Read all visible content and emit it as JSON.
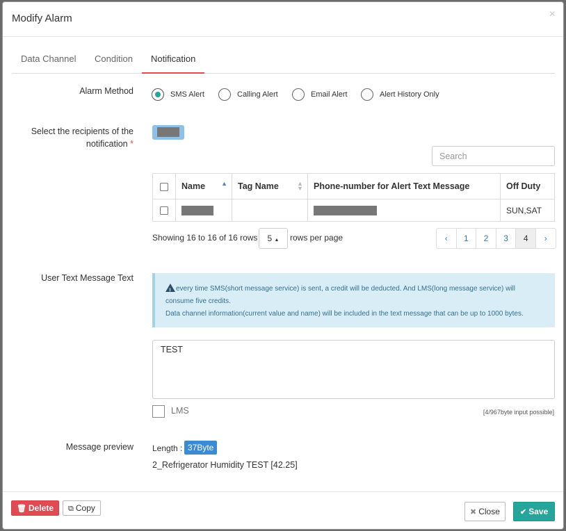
{
  "modal": {
    "title": "Modify Alarm",
    "close_glyph": "×"
  },
  "tabs": [
    {
      "label": "Data Channel",
      "active": false
    },
    {
      "label": "Condition",
      "active": false
    },
    {
      "label": "Notification",
      "active": true
    }
  ],
  "alarm_method": {
    "label": "Alarm Method",
    "options": [
      {
        "label": "SMS Alert",
        "selected": true
      },
      {
        "label": "Calling Alert",
        "selected": false
      },
      {
        "label": "Email Alert",
        "selected": false
      },
      {
        "label": "Alert History Only",
        "selected": false
      }
    ]
  },
  "recipients": {
    "label_line1": "Select the recipients of the",
    "label_line2": "notification",
    "required_mark": "*",
    "search_placeholder": "Search",
    "columns": [
      "Name",
      "Tag Name",
      "Phone-number for Alert Text Message",
      "Off Duty"
    ],
    "rows": [
      {
        "name": "",
        "tag_name": "",
        "phone": "",
        "off_duty": "SUN,SAT"
      }
    ],
    "showing_text": "Showing 16 to 16 of 16 rows",
    "rows_per_page_value": "5",
    "rows_per_page_label": "rows per page",
    "pages": [
      "‹",
      "1",
      "2",
      "3",
      "4",
      "›"
    ],
    "active_page": "4"
  },
  "user_text": {
    "label": "User Text Message Text",
    "alert_line1": "every time SMS(short message service) is sent, a credit will be deducted. And LMS(long message service) will",
    "alert_line2": "consume five credits.",
    "alert_line3": "Data channel information(current value and name) will be included in the text message that can be up to 1000 bytes.",
    "message_value": "TEST",
    "lms_label": "LMS",
    "bytes_info": "[4/967byte input possible]"
  },
  "preview": {
    "label": "Message preview",
    "length_label": "Length :",
    "length_value": "37Byte",
    "text": "2_Refrigerator Humidity TEST [42.25]"
  },
  "footer": {
    "delete_label": "Delete",
    "copy_label": "Copy",
    "close_label": "Close",
    "save_label": "Save"
  },
  "colors": {
    "accent": "#26a69a",
    "danger": "#e04b53",
    "tab_underline": "#e04b4b",
    "badge": "#3a8ad4",
    "info_bg": "#d9edf7"
  }
}
